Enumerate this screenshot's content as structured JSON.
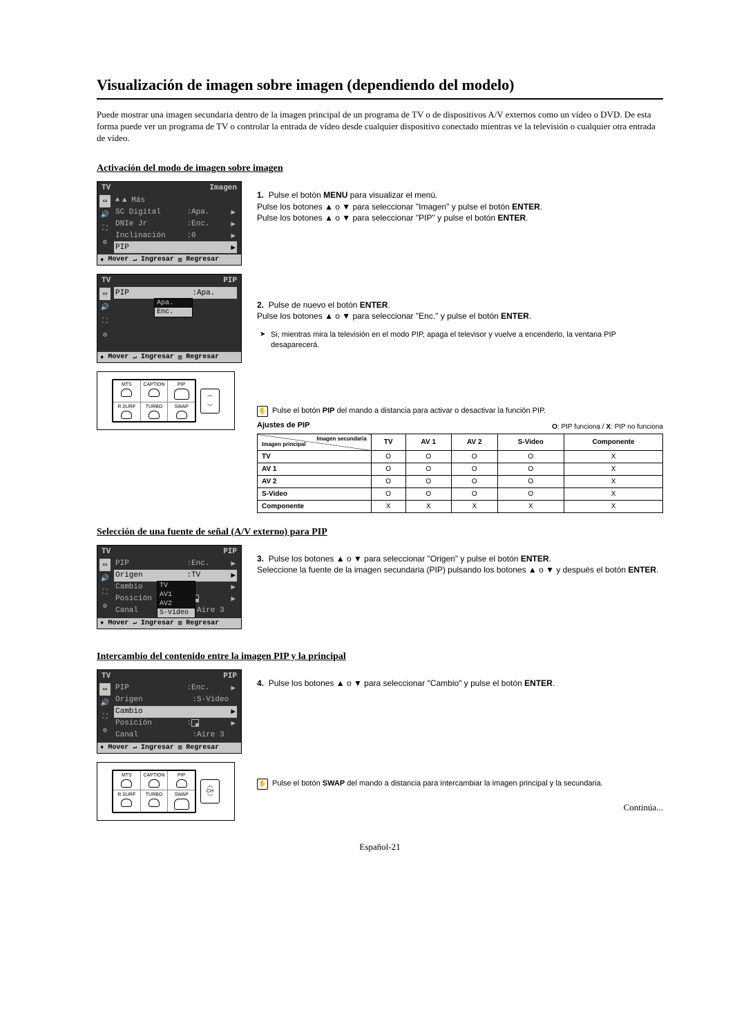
{
  "title": "Visualización de imagen sobre imagen (dependiendo del modelo)",
  "intro": "Puede mostrar una imagen secundaria dentro de la imagen principal de un programa de TV o de dispositivos A/V externos como un vídeo o DVD. De esta forma puede ver un programa de TV o controlar la entrada de vídeo desde cualquier dispositivo conectado mientras ve la televisión o cualquier otra entrada de vídeo.",
  "sections": {
    "s1": "Activación del modo de imagen sobre imagen",
    "s2": "Selección de una fuente de señal (A/V externo) para PIP",
    "s3": "Intercambio del contenido entre la imagen PIP y la principal"
  },
  "steps": {
    "1": {
      "num": "1.",
      "l1a": "Pulse el botón ",
      "l1b": "MENU",
      "l1c": " para visualizar el menú.",
      "l2a": "Pulse los botones ▲ o ▼ para seleccionar \"Imagen\" y pulse el botón ",
      "l2b": "ENTER",
      "l2c": ".",
      "l3a": "Pulse los botones ▲ o ▼ para seleccionar \"PIP\" y pulse el botón ",
      "l3b": "ENTER",
      "l3c": "."
    },
    "2": {
      "num": "2.",
      "l1a": "Pulse de nuevo el botón ",
      "l1b": "ENTER",
      "l1c": ".",
      "l2a": "Pulse los botones ▲ o ▼ para seleccionar \"Enc.\" y pulse el botón ",
      "l2b": "ENTER",
      "l2c": ".",
      "note": "Si, mientras mira la televisión en el modo PIP, apaga el televisor y vuelve a encenderlo, la ventana PIP desaparecerá."
    },
    "3": {
      "num": "3.",
      "l1a": "Pulse los botones ▲ o ▼ para seleccionar \"Origen\" y pulse el botón ",
      "l1b": "ENTER",
      "l1c": ".",
      "l2": "Seleccione la fuente de la imagen secundaria (PIP) pulsando los botones ▲ o ▼ y después el botón ",
      "l2b": "ENTER",
      "l2c": "."
    },
    "4": {
      "num": "4.",
      "l1a": "Pulse los botones ▲ o ▼ para seleccionar \"Cambio\" y pulse el botón ",
      "l1b": "ENTER",
      "l1c": "."
    }
  },
  "remote_notes": {
    "pip": {
      "a": "Pulse el botón ",
      "b": "PIP",
      "c": " del mando a distancia para activar o desactivar la función PIP."
    },
    "swap": {
      "a": "Pulse el botón ",
      "b": "SWAP",
      "c": " del mando a distancia para intercambiar la imagen principal y la secundaria."
    }
  },
  "osd": {
    "common": {
      "tv": "TV",
      "footer_move": "Mover",
      "footer_enter": "Ingresar",
      "footer_return": "Regresar"
    },
    "imagen": {
      "title": "Imagen",
      "more": "▲ Más",
      "items": [
        {
          "label": "SC Digital",
          "value": "Apa.",
          "arrow": true
        },
        {
          "label": "DNIe Jr",
          "value": "Enc.",
          "arrow": true
        },
        {
          "label": "Inclinación",
          "value": "0",
          "arrow": true
        },
        {
          "label": "PIP",
          "value": "",
          "arrow": true,
          "sel": true
        }
      ]
    },
    "pip_enc": {
      "title": "PIP",
      "item": {
        "label": "PIP",
        "value": "Apa.",
        "sel": true
      },
      "dropdown": [
        "Apa.",
        "Enc."
      ],
      "dropdown_sel": 1
    },
    "pip_origen": {
      "title": "PIP",
      "items": [
        {
          "label": "PIP",
          "value": "Enc.",
          "arrow": true
        },
        {
          "label": "Origen",
          "value": "TV",
          "arrow": true,
          "sel": true
        },
        {
          "label": "Cambio",
          "value": "",
          "arrow": true
        },
        {
          "label": "Posición",
          "value": "◳",
          "arrow": true
        },
        {
          "label": "Canal",
          "value": "Aire 3"
        }
      ],
      "dropdown": [
        "TV",
        "AV1",
        "AV2",
        "S-Video"
      ],
      "dropdown_sel": 3
    },
    "pip_cambio": {
      "title": "PIP",
      "items": [
        {
          "label": "PIP",
          "value": "Enc.",
          "arrow": true
        },
        {
          "label": "Origen",
          "value": "S-Video"
        },
        {
          "label": "Cambio",
          "value": "",
          "arrow": true,
          "sel": true
        },
        {
          "label": "Posición",
          "value": "◳",
          "arrow": true
        },
        {
          "label": "Canal",
          "value": "Aire 3"
        }
      ]
    }
  },
  "remote": {
    "row1": [
      "MTS",
      "CAPTION",
      "PIP"
    ],
    "row2": [
      "R.SURF",
      "TURBO",
      "SWAP"
    ],
    "ch": "CH"
  },
  "compat": {
    "heading": "Ajustes de PIP",
    "legend_a": "O",
    "legend_at": ": PIP funciona / ",
    "legend_b": "X",
    "legend_bt": ": PIP no funciona",
    "corner_top": "Imagen\nsecundaria",
    "corner_bottom": "Imagen principal",
    "cols": [
      "TV",
      "AV 1",
      "AV 2",
      "S-Video",
      "Componente"
    ],
    "rows": [
      {
        "h": "TV",
        "v": [
          "O",
          "O",
          "O",
          "O",
          "X"
        ]
      },
      {
        "h": "AV 1",
        "v": [
          "O",
          "O",
          "O",
          "O",
          "X"
        ]
      },
      {
        "h": "AV 2",
        "v": [
          "O",
          "O",
          "O",
          "O",
          "X"
        ]
      },
      {
        "h": "S-Video",
        "v": [
          "O",
          "O",
          "O",
          "O",
          "X"
        ]
      },
      {
        "h": "Componente",
        "v": [
          "X",
          "X",
          "X",
          "X",
          "X"
        ]
      }
    ]
  },
  "continued": "Continúa...",
  "pagenum": "Español-21"
}
